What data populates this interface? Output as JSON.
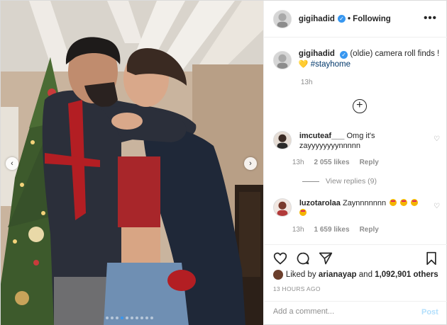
{
  "post": {
    "username": "gigihadid",
    "follow_status": "Following",
    "more_icon": "•••",
    "caption_user": "gigihadid",
    "caption_text": "(oldie) camera roll finds !",
    "caption_emoji": "💛",
    "caption_hashtag": "#stayhome",
    "caption_time": "13h",
    "load_more_icon": "+",
    "carousel_total": 10,
    "carousel_active": 3
  },
  "comments": [
    {
      "user": "imcuteaf___",
      "text": "Omg it's zayyyyyyyynnnnn",
      "time": "13h",
      "likes": "2 055 likes",
      "reply": "Reply",
      "view_replies": "View replies (9)"
    },
    {
      "user": "luzotarolaa",
      "text": "Zaynnnnnnn",
      "time": "13h",
      "likes": "1 659 likes",
      "reply": "Reply"
    }
  ],
  "actions": {
    "liked_prefix": "Liked by",
    "liked_user": "arianayap",
    "liked_and": "and",
    "liked_count": "1,092,901 others",
    "posted_ago": "13 HOURS AGO",
    "comment_placeholder": "Add a comment...",
    "post_label": "Post"
  },
  "icons": {
    "arrow_left": "‹",
    "arrow_right": "›",
    "verified": "✓",
    "heart_outline": "♡"
  },
  "colors": {
    "accent": "#3897f0",
    "post_disabled": "#b2dffc",
    "hashtag": "#00376b",
    "muted": "#8e8e8e"
  }
}
